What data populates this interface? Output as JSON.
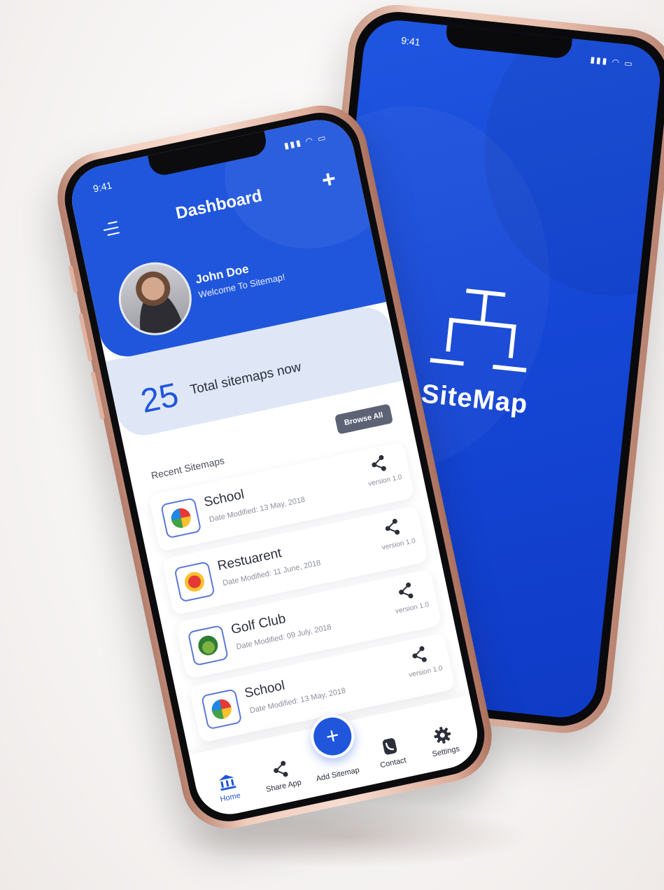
{
  "colors": {
    "brand": "#1f56dc",
    "brand_dark": "#0f3bc6",
    "card_bg": "#ffffff",
    "muted": "#8c8f9a",
    "chip": "#5d6275"
  },
  "splash": {
    "time": "9:41",
    "status_icons": [
      "signal-icon",
      "wifi-icon",
      "battery-icon"
    ],
    "app_name": "SiteMap"
  },
  "dashboard": {
    "time": "9:41",
    "status_icons": [
      "signal-icon",
      "wifi-icon",
      "battery-icon"
    ],
    "title": "Dashboard",
    "add_icon": "+",
    "user": {
      "name": "John Doe",
      "welcome": "Welcome To Sitemap!"
    },
    "total": {
      "count": "25",
      "label": "Total sitemaps now"
    },
    "recent_label": "Recent Sitemaps",
    "browse_label": "Browse All",
    "sitemaps": [
      {
        "name": "School",
        "date": "Date Modified: 13 May, 2018",
        "version": "version 1.0",
        "logo": "school-logo"
      },
      {
        "name": "Restuarent",
        "date": "Date Modified: 11 June, 2018",
        "version": "version 1.0",
        "logo": "restaurant-logo"
      },
      {
        "name": "Golf Club",
        "date": "Date Modified: 09 July, 2018",
        "version": "version 1.0",
        "logo": "golf-logo"
      },
      {
        "name": "School",
        "date": "Date Modified: 13 May, 2018",
        "version": "version 1.0",
        "logo": "school-logo"
      }
    ],
    "nav": {
      "home": "Home",
      "share": "Share App",
      "add": "Add Sitemap",
      "add_icon": "+",
      "contact": "Contact",
      "settings": "Settings"
    }
  }
}
